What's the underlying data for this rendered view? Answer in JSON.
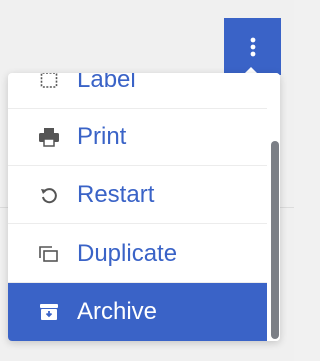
{
  "menu": {
    "items": [
      {
        "label": "Label",
        "icon": "label-icon"
      },
      {
        "label": "Print",
        "icon": "printer-icon"
      },
      {
        "label": "Restart",
        "icon": "restart-icon"
      },
      {
        "label": "Duplicate",
        "icon": "duplicate-icon"
      },
      {
        "label": "Archive",
        "icon": "archive-icon"
      }
    ],
    "active_item": "Archive"
  },
  "colors": {
    "accent": "#3a63c7",
    "icon_gray": "#555555",
    "scrollbar": "#7b7f86"
  }
}
